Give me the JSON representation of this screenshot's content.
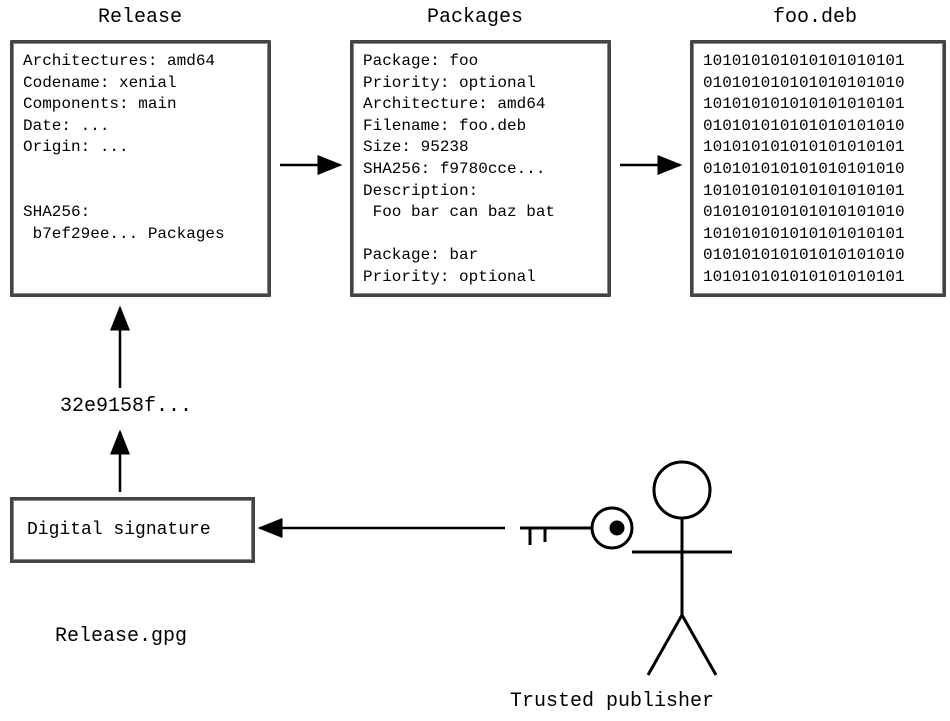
{
  "titles": {
    "release": "Release",
    "packages": "Packages",
    "foodeb": "foo.deb"
  },
  "release_box": "Architectures: amd64\nCodename: xenial\nComponents: main\nDate: ...\nOrigin: ...\n\n\nSHA256:\n b7ef29ee... Packages",
  "packages_box": "Package: foo\nPriority: optional\nArchitecture: amd64\nFilename: foo.deb\nSize: 95238\nSHA256: f9780cce...\nDescription:\n Foo bar can baz bat\n\nPackage: bar\nPriority: optional",
  "foodeb_box": "101010101010101010101\n010101010101010101010\n101010101010101010101\n010101010101010101010\n101010101010101010101\n010101010101010101010\n101010101010101010101\n010101010101010101010\n101010101010101010101\n010101010101010101010\n101010101010101010101",
  "hash_label": "32e9158f...",
  "signature_box": "Digital signature",
  "release_gpg": "Release.gpg",
  "trusted_publisher": "Trusted publisher"
}
